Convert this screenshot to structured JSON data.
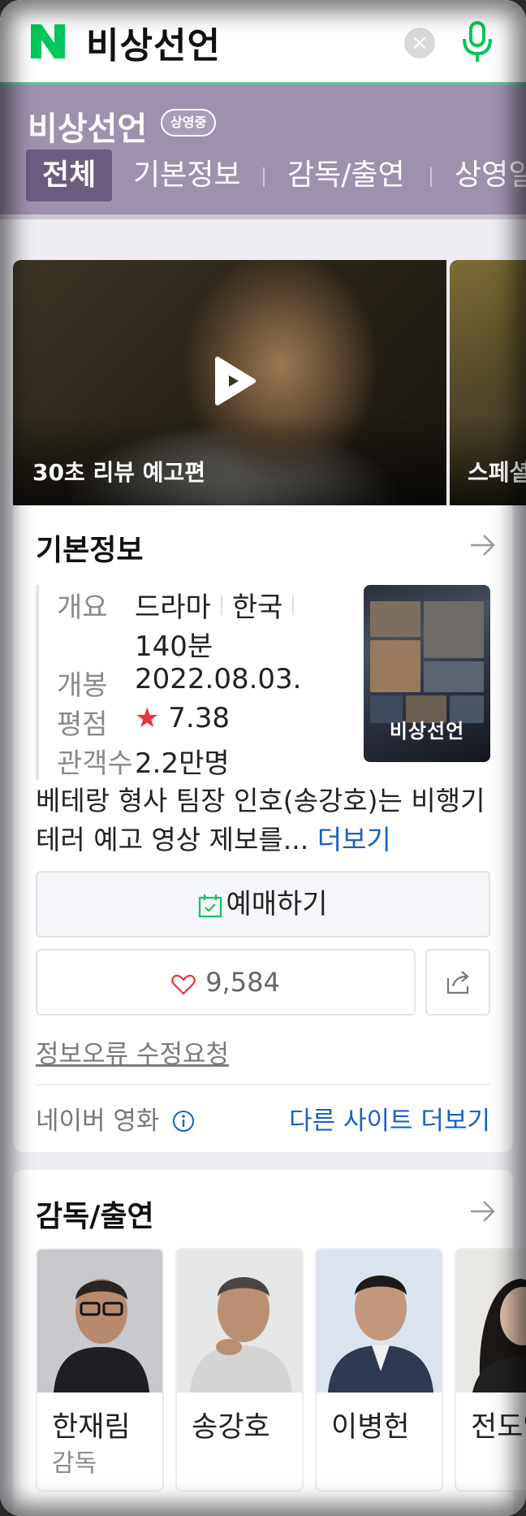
{
  "search": {
    "query": "비상선언",
    "clear_label": "×"
  },
  "colors": {
    "naver_green": "#03c75a",
    "header_purple": "#9e91ad",
    "tab_active": "#6c5d80",
    "link_blue": "#1b5fc1",
    "star_red": "#e5333f"
  },
  "movie": {
    "title": "비상선언",
    "status": "상영중"
  },
  "tabs": [
    {
      "label": "전체",
      "active": true
    },
    {
      "label": "기본정보",
      "active": false
    },
    {
      "label": "감독/출연",
      "active": false
    },
    {
      "label": "상영일",
      "active": false
    }
  ],
  "videos": [
    {
      "caption": "30초 리뷰 예고편"
    },
    {
      "caption": "스페셜"
    }
  ],
  "basic_info": {
    "section_title": "기본정보",
    "rows": [
      {
        "label": "개요",
        "genre": "드라마",
        "country": "한국",
        "runtime": "140분"
      },
      {
        "label": "개봉",
        "value": "2022.08.03."
      },
      {
        "label": "평점",
        "star": "★",
        "value": "7.38"
      },
      {
        "label": "관객수",
        "value": "2.2만명"
      }
    ],
    "poster_title": "비상선언",
    "synopsis": "베테랑 형사 팀장 인호(송강호)는 비행기 테러 예고 영상 제보를...",
    "more_label": "더보기",
    "reserve_label": "예매하기",
    "like_count": "9,584",
    "report_label": "정보오류 수정요청",
    "source_label": "네이버 영화",
    "other_sites_label": "다른 사이트 더보기"
  },
  "cast": {
    "section_title": "감독/출연",
    "people": [
      {
        "name": "한재림",
        "role": "감독"
      },
      {
        "name": "송강호",
        "role": ""
      },
      {
        "name": "이병헌",
        "role": ""
      },
      {
        "name": "전도연",
        "role": ""
      }
    ]
  }
}
